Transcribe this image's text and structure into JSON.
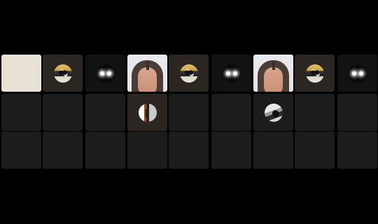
{
  "boards": [
    {
      "cells": [
        {
          "kind": "beige"
        },
        {
          "kind": "token",
          "token": "photo-token-icon"
        },
        {
          "kind": "token",
          "token": "glow-token-icon"
        },
        {
          "kind": "empty"
        },
        {
          "kind": "empty"
        },
        {
          "kind": "empty"
        },
        {
          "kind": "empty"
        },
        {
          "kind": "empty"
        },
        {
          "kind": "empty"
        }
      ]
    },
    {
      "cells": [
        {
          "kind": "face"
        },
        {
          "kind": "token",
          "token": "photo-token-icon"
        },
        {
          "kind": "token",
          "token": "glow-token-icon"
        },
        {
          "kind": "token",
          "token": "door-token-icon"
        },
        {
          "kind": "empty"
        },
        {
          "kind": "empty"
        },
        {
          "kind": "empty"
        },
        {
          "kind": "empty"
        },
        {
          "kind": "empty"
        }
      ]
    },
    {
      "cells": [
        {
          "kind": "face"
        },
        {
          "kind": "token",
          "token": "photo-token-icon"
        },
        {
          "kind": "token",
          "token": "glow-token-icon"
        },
        {
          "kind": "token",
          "token": "bw-token-icon"
        },
        {
          "kind": "empty"
        },
        {
          "kind": "empty"
        },
        {
          "kind": "empty"
        },
        {
          "kind": "empty"
        },
        {
          "kind": "empty"
        }
      ]
    }
  ]
}
